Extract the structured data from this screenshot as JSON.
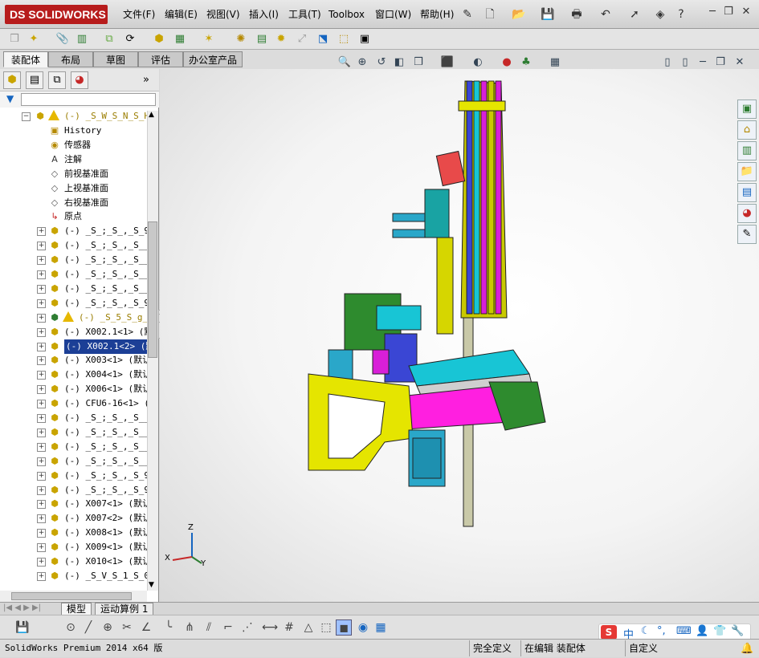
{
  "app": {
    "logo": "DS SOLIDWORKS"
  },
  "menu": [
    "文件(F)",
    "编辑(E)",
    "视图(V)",
    "插入(I)",
    "工具(T)",
    "Toolbox",
    "窗口(W)",
    "帮助(H)"
  ],
  "command_tabs": [
    "装配体",
    "布局",
    "草图",
    "评估",
    "办公室产品"
  ],
  "feature_tree": {
    "root": "(-) _S_W_S_N_S_H_",
    "items": [
      {
        "label": "History",
        "icon": "history-icon",
        "expander": false
      },
      {
        "label": "传感器",
        "icon": "sensor-icon",
        "expander": false
      },
      {
        "label": "注解",
        "icon": "annotation-icon",
        "expander": false
      },
      {
        "label": "前视基准面",
        "icon": "plane-icon",
        "expander": false
      },
      {
        "label": "上视基准面",
        "icon": "plane-icon",
        "expander": false
      },
      {
        "label": "右视基准面",
        "icon": "plane-icon",
        "expander": false
      },
      {
        "label": "原点",
        "icon": "origin-icon",
        "expander": false
      },
      {
        "label": "(-) _S_;_S_,_S_9_",
        "icon": "part-icon",
        "expander": true
      },
      {
        "label": "(-) _S_;_S_,_S___",
        "icon": "part-icon",
        "expander": true
      },
      {
        "label": "(-) _S_;_S_,_S___",
        "icon": "part-icon",
        "expander": true
      },
      {
        "label": "(-) _S_;_S_,_S___",
        "icon": "part-icon",
        "expander": true
      },
      {
        "label": "(-) _S_;_S_,_S___",
        "icon": "part-icon",
        "expander": true
      },
      {
        "label": "(-) _S_;_S_,_S_9_",
        "icon": "part-icon",
        "expander": true
      },
      {
        "label": "(-) _S_5_S_g_S",
        "icon": "subassembly-warning-icon",
        "expander": true
      },
      {
        "label": "(-) X002.1<1> (默",
        "icon": "part-icon",
        "expander": true
      },
      {
        "label": "(-) X002.1<2> (默",
        "icon": "part-icon",
        "expander": true,
        "selected": true
      },
      {
        "label": "(-) X003<1> (默认",
        "icon": "part-icon",
        "expander": true
      },
      {
        "label": "(-) X004<1> (默认",
        "icon": "part-icon",
        "expander": true
      },
      {
        "label": "(-) X006<1> (默认",
        "icon": "part-icon",
        "expander": true
      },
      {
        "label": "(-) CFU6-16<1> (",
        "icon": "part-icon",
        "expander": true
      },
      {
        "label": "(-) _S_;_S_,_S___",
        "icon": "part-icon",
        "expander": true
      },
      {
        "label": "(-) _S_;_S_,_S___",
        "icon": "part-icon",
        "expander": true
      },
      {
        "label": "(-) _S_;_S_,_S___",
        "icon": "part-icon",
        "expander": true
      },
      {
        "label": "(-) _S_;_S_,_S___",
        "icon": "part-icon",
        "expander": true
      },
      {
        "label": "(-) _S_;_S_,_S_9_",
        "icon": "part-icon",
        "expander": true
      },
      {
        "label": "(-) _S_;_S_,_S_9_",
        "icon": "part-icon",
        "expander": true
      },
      {
        "label": "(-) X007<1> (默认",
        "icon": "part-icon",
        "expander": true
      },
      {
        "label": "(-) X007<2> (默认",
        "icon": "part-icon",
        "expander": true
      },
      {
        "label": "(-) X008<1> (默认",
        "icon": "part-icon",
        "expander": true
      },
      {
        "label": "(-) X009<1> (默认",
        "icon": "part-icon",
        "expander": true
      },
      {
        "label": "(-) X010<1> (默认",
        "icon": "part-icon",
        "expander": true
      },
      {
        "label": "(-) _S_V_S_1_S_0_",
        "icon": "part-icon",
        "expander": true
      }
    ]
  },
  "bottom_tabs": [
    "模型",
    "运动算例 1"
  ],
  "status": {
    "product": "SolidWorks Premium 2014 x64 版",
    "definition": "完全定义",
    "mode": "在编辑 装配体",
    "custom": "自定义"
  },
  "ime": {
    "label": "中"
  },
  "axes": {
    "x": "X",
    "y": "Y",
    "z": "Z"
  }
}
